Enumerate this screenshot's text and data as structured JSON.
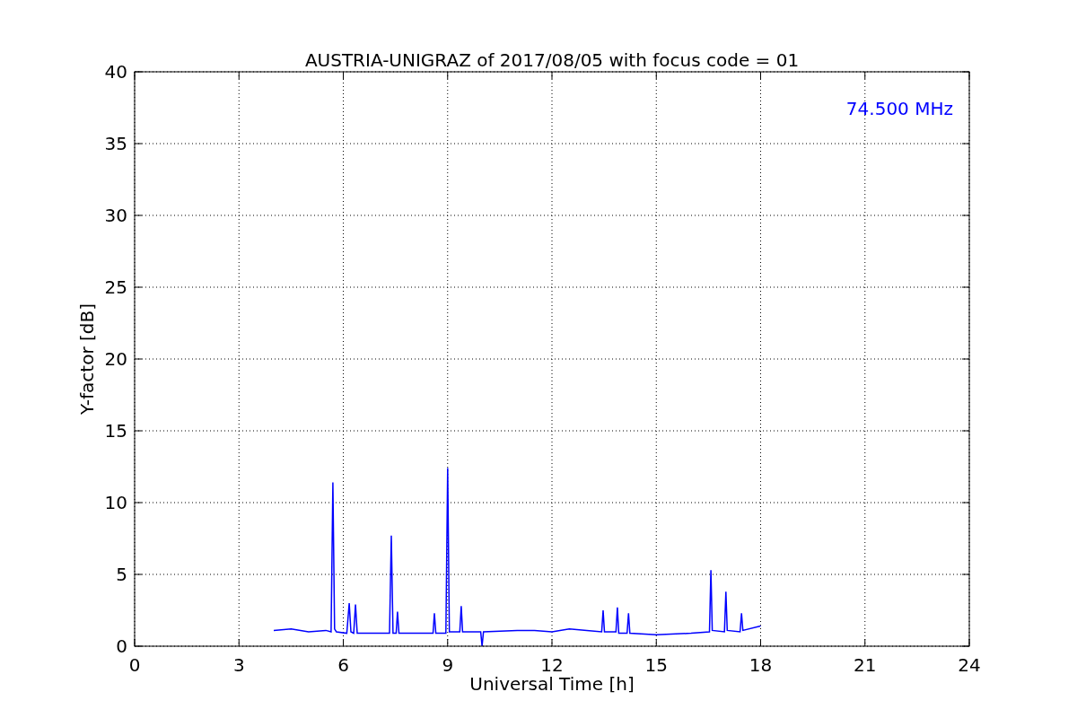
{
  "figure": {
    "chart_data": {
      "type": "line",
      "title": "AUSTRIA-UNIGRAZ of 2017/08/05 with focus code = 01",
      "xlabel": "Universal Time [h]",
      "ylabel": "Y-factor [dB]",
      "xlim": [
        0,
        24
      ],
      "ylim": [
        0,
        40
      ],
      "xticks": [
        0,
        3,
        6,
        9,
        12,
        15,
        18,
        21,
        24
      ],
      "yticks": [
        0,
        5,
        10,
        15,
        20,
        25,
        30,
        35,
        40
      ],
      "x": [
        4.0,
        4.5,
        5.0,
        5.5,
        5.65,
        5.7,
        5.75,
        5.8,
        6.1,
        6.17,
        6.22,
        6.3,
        6.35,
        6.4,
        7.0,
        7.33,
        7.38,
        7.43,
        7.52,
        7.56,
        7.6,
        8.0,
        8.58,
        8.62,
        8.66,
        8.95,
        9.0,
        9.05,
        9.35,
        9.39,
        9.43,
        9.95,
        9.99,
        10.03,
        11.0,
        11.5,
        12.0,
        12.5,
        13.0,
        13.43,
        13.47,
        13.51,
        13.84,
        13.88,
        13.92,
        14.16,
        14.2,
        14.24,
        15.0,
        16.0,
        16.53,
        16.57,
        16.61,
        16.96,
        17.0,
        17.04,
        17.41,
        17.45,
        17.49,
        18.0
      ],
      "grid": true,
      "series": [
        {
          "color": "#0000ff",
          "values": [
            1.1,
            1.2,
            1.0,
            1.1,
            1.0,
            11.4,
            1.2,
            1.0,
            0.9,
            3.0,
            1.0,
            0.9,
            2.9,
            0.9,
            0.9,
            0.9,
            7.7,
            0.9,
            0.9,
            2.4,
            0.9,
            0.9,
            0.9,
            2.3,
            0.9,
            0.9,
            12.4,
            1.0,
            1.0,
            2.8,
            1.0,
            1.0,
            0.0,
            1.0,
            1.1,
            1.1,
            1.0,
            1.2,
            1.1,
            1.0,
            2.5,
            1.0,
            1.0,
            2.7,
            0.9,
            0.9,
            2.3,
            0.9,
            0.8,
            0.9,
            1.0,
            5.3,
            1.1,
            1.0,
            3.8,
            1.1,
            1.0,
            2.3,
            1.1,
            1.4
          ]
        }
      ],
      "annotations": [
        {
          "text": "74.500 MHz"
        }
      ]
    }
  }
}
